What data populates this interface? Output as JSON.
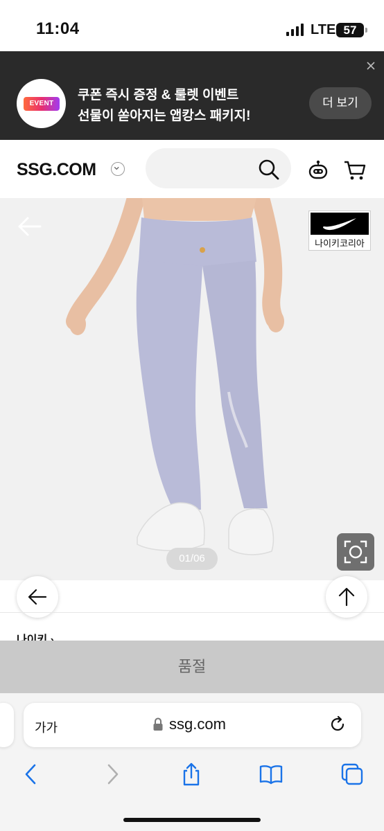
{
  "status_bar": {
    "time": "11:04",
    "network": "LTE",
    "battery": "57"
  },
  "event_banner": {
    "badge": "EVENT",
    "line1": "쿠폰 즉시 증정 & 룰렛 이벤트",
    "line2": "선물이 쏟아지는 앱캉스 패키지!",
    "more_label": "더 보기"
  },
  "header": {
    "logo": "SSG.COM"
  },
  "product": {
    "brand_badge_text": "나이키코리아",
    "image_counter": "01/06",
    "brand_link": "나이키 ›"
  },
  "soldout_label": "품절",
  "browser": {
    "text_size_label": "가가",
    "url": "ssg.com"
  },
  "colors": {
    "banner_bg": "#2a2a2a",
    "soldout_bg": "#c9c9c9",
    "legging_color": "#b8bad6"
  }
}
